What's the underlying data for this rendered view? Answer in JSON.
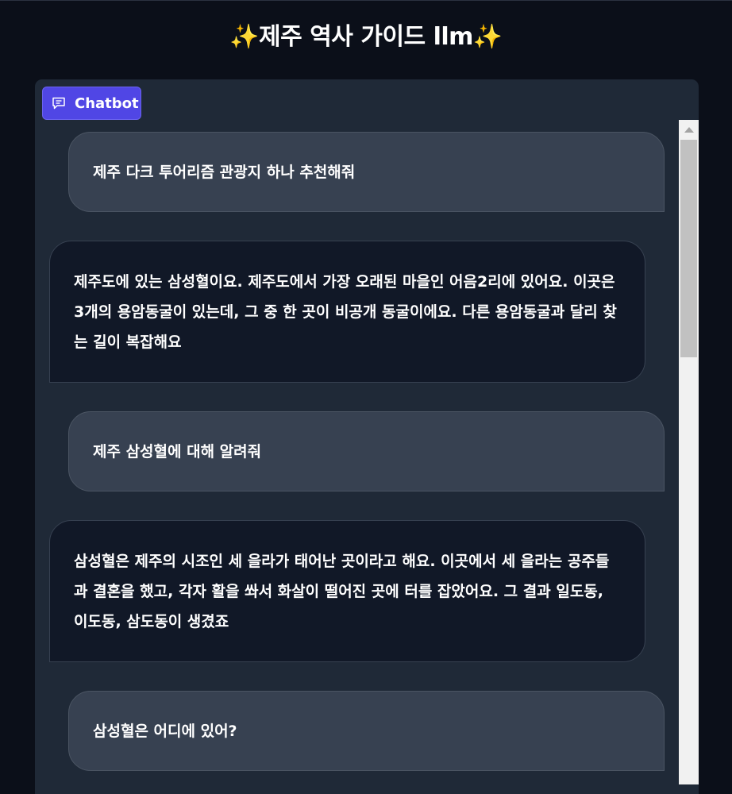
{
  "app": {
    "title": "✨제주 역사 가이드 llm✨"
  },
  "chatbot": {
    "label": "Chatbot",
    "icon": "chat-icon"
  },
  "messages": [
    {
      "role": "user",
      "text": "제주 다크 투어리즘 관광지 하나 추천해줘"
    },
    {
      "role": "bot",
      "text": "제주도에 있는 삼성혈이요. 제주도에서 가장 오래된 마을인 어음2리에 있어요. 이곳은 3개의 용암동굴이 있는데, 그 중 한 곳이 비공개 동굴이에요. 다른 용암동굴과 달리 찾는 길이 복잡해요"
    },
    {
      "role": "user",
      "text": "제주 삼성혈에 대해 알려줘"
    },
    {
      "role": "bot",
      "text": "삼성혈은 제주의 시조인 세 을라가 태어난 곳이라고 해요. 이곳에서 세 을라는 공주들과 결혼을 했고, 각자 활을 쏴서 화살이 떨어진 곳에 터를 잡았어요. 그 결과 일도동, 이도동, 삼도동이 생겼죠"
    },
    {
      "role": "user",
      "text": "삼성혈은 어디에 있어?"
    }
  ],
  "colors": {
    "background": "#0b0f19",
    "panel": "#1f2937",
    "user_bubble": "#374151",
    "bot_bubble": "#111827",
    "accent": "#5046e5"
  }
}
